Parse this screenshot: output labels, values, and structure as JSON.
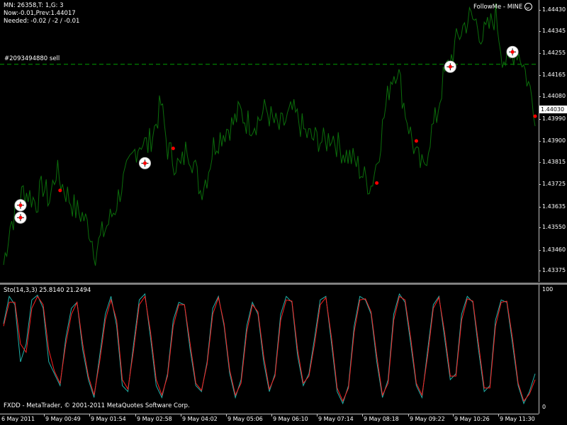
{
  "info": {
    "line1": "MN: 26358,T: 1,G: 3",
    "line2": "Now:-0.01,Prev:1.44017",
    "line3": "Needed: -0.02 / -2 / -0.01"
  },
  "expert_label": "FollowMe - MINE",
  "order_label": "#2093494880 sell",
  "current_price": "1.44030",
  "indicator_label": "Sto(14,3,3) 25.8140 21.2494",
  "copyright": "FXDD - MetaTrader, © 2001-2011 MetaQuotes Software Corp.",
  "colors": {
    "price_line": "#0b6e0b",
    "stoch_main": "#20b2aa",
    "stoch_signal": "#ff2020",
    "order_level": "#00a000",
    "marker_dot": "#ff0000"
  },
  "chart_data": [
    {
      "type": "line",
      "title": "",
      "ylim": [
        1.4333,
        1.4447
      ],
      "y_ticks": [
        "1.44430",
        "1.44345",
        "1.44255",
        "1.44165",
        "1.44080",
        "1.43990",
        "1.43900",
        "1.43815",
        "1.43725",
        "1.43635",
        "1.43550",
        "1.43460",
        "1.43375"
      ],
      "order_level": 1.4421,
      "series": [
        {
          "values": [
            1.434,
            1.4356,
            1.4362,
            1.437,
            1.4368,
            1.4365,
            1.4372,
            1.4366,
            1.4378,
            1.4372,
            1.4367,
            1.4362,
            1.436,
            1.4355,
            1.4345,
            1.4352,
            1.4357,
            1.4363,
            1.4372,
            1.4378,
            1.4386,
            1.439,
            1.4388,
            1.4395,
            1.4405,
            1.4387,
            1.4382,
            1.4379,
            1.4388,
            1.4381,
            1.437,
            1.4376,
            1.4388,
            1.4392,
            1.4395,
            1.4397,
            1.4402,
            1.4398,
            1.4397,
            1.4399,
            1.4403,
            1.4398,
            1.4395,
            1.4398,
            1.4402,
            1.4398,
            1.4393,
            1.4391,
            1.4391,
            1.4389,
            1.4393,
            1.4388,
            1.4385,
            1.4383,
            1.438,
            1.4375,
            1.4372,
            1.4383,
            1.44,
            1.4415,
            1.442,
            1.4405,
            1.4393,
            1.4383,
            1.4378,
            1.4392,
            1.44,
            1.4415,
            1.4422,
            1.443,
            1.4436,
            1.444,
            1.4438,
            1.4432,
            1.4436,
            1.4441,
            1.4425,
            1.442,
            1.4428,
            1.4423,
            1.4413,
            1.4402
          ]
        }
      ],
      "markers": [
        {
          "x": 3,
          "y": 1.4364,
          "circled": true,
          "kind": "buy"
        },
        {
          "x": 3,
          "y": 1.4359,
          "circled": true,
          "kind": "buy"
        },
        {
          "x": 10,
          "y": 1.437,
          "circled": false,
          "kind": "close"
        },
        {
          "x": 25,
          "y": 1.4381,
          "circled": true,
          "kind": "buy"
        },
        {
          "x": 30,
          "y": 1.4387,
          "circled": false,
          "kind": "close"
        },
        {
          "x": 66,
          "y": 1.4373,
          "circled": false,
          "kind": "close"
        },
        {
          "x": 73,
          "y": 1.439,
          "circled": false,
          "kind": "close"
        },
        {
          "x": 79,
          "y": 1.442,
          "circled": true,
          "kind": "sell"
        },
        {
          "x": 90,
          "y": 1.4426,
          "circled": true,
          "kind": "sell"
        },
        {
          "x": 94,
          "y": 1.44,
          "circled": false,
          "kind": "close"
        }
      ],
      "x_count": 95
    },
    {
      "type": "line",
      "title": "Sto(14,3,3) 25.8140 21.2494",
      "ylim": [
        0,
        100
      ],
      "y_ticks": [
        "100",
        "0"
      ],
      "series": [
        {
          "name": "main",
          "values": [
            72,
            95,
            88,
            40,
            55,
            92,
            96,
            85,
            40,
            30,
            20,
            60,
            85,
            90,
            50,
            25,
            10,
            45,
            80,
            95,
            70,
            20,
            15,
            55,
            92,
            97,
            60,
            20,
            10,
            30,
            75,
            90,
            88,
            50,
            20,
            15,
            40,
            85,
            95,
            70,
            30,
            10,
            25,
            70,
            90,
            80,
            40,
            15,
            30,
            80,
            95,
            90,
            45,
            20,
            30,
            60,
            92,
            95,
            55,
            15,
            5,
            20,
            70,
            95,
            92,
            80,
            40,
            10,
            25,
            80,
            97,
            90,
            55,
            20,
            10,
            50,
            88,
            95,
            60,
            25,
            30,
            80,
            95,
            90,
            50,
            15,
            20,
            75,
            92,
            90,
            55,
            20,
            5,
            15,
            30
          ]
        },
        {
          "name": "signal",
          "values": [
            70,
            90,
            90,
            55,
            48,
            85,
            95,
            88,
            50,
            32,
            22,
            55,
            80,
            90,
            55,
            28,
            12,
            40,
            75,
            92,
            75,
            25,
            17,
            50,
            88,
            95,
            65,
            25,
            12,
            28,
            70,
            88,
            88,
            55,
            22,
            16,
            38,
            80,
            94,
            72,
            33,
            12,
            22,
            65,
            88,
            82,
            45,
            17,
            28,
            75,
            92,
            91,
            50,
            22,
            28,
            55,
            88,
            94,
            60,
            18,
            7,
            18,
            65,
            92,
            93,
            82,
            45,
            12,
            22,
            75,
            95,
            92,
            60,
            22,
            12,
            45,
            85,
            94,
            65,
            28,
            28,
            75,
            93,
            91,
            55,
            18,
            18,
            70,
            90,
            91,
            60,
            22,
            7,
            13,
            25
          ]
        }
      ]
    }
  ],
  "price_axis": [
    "1.44430",
    "1.44345",
    "1.44255",
    "1.44165",
    "1.44080",
    "1.43990",
    "1.43900",
    "1.43815",
    "1.43725",
    "1.43635",
    "1.43550",
    "1.43460",
    "1.43375"
  ],
  "osc_axis": {
    "top": "100",
    "bottom": "0"
  },
  "time_axis": [
    "6 May 2011",
    "9 May 00:49",
    "9 May 01:54",
    "9 May 02:58",
    "9 May 04:02",
    "9 May 05:06",
    "9 May 06:10",
    "9 May 07:14",
    "9 May 08:18",
    "9 May 09:22",
    "9 May 10:26",
    "9 May 11:30"
  ]
}
